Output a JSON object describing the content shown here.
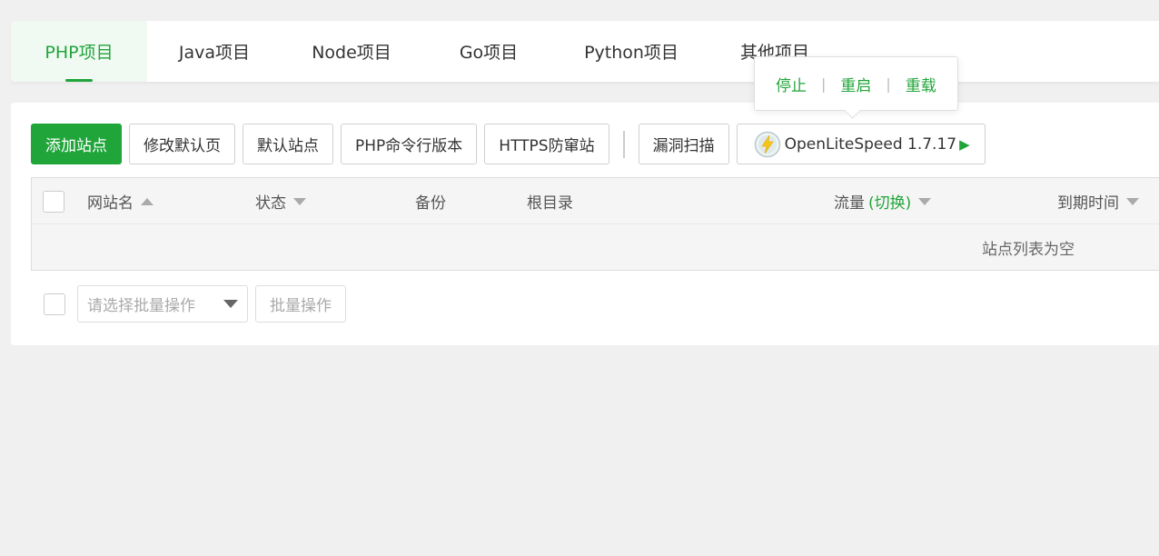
{
  "tabs": [
    {
      "label": "PHP项目",
      "active": true
    },
    {
      "label": "Java项目",
      "active": false
    },
    {
      "label": "Node项目",
      "active": false
    },
    {
      "label": "Go项目",
      "active": false
    },
    {
      "label": "Python项目",
      "active": false
    },
    {
      "label": "其他项目",
      "active": false
    }
  ],
  "toolbar": {
    "add_site": "添加站点",
    "edit_default_page": "修改默认页",
    "default_site": "默认站点",
    "php_cli_version": "PHP命令行版本",
    "https_anti_hijack": "HTTPS防窜站",
    "vuln_scan": "漏洞扫描",
    "server_name": "OpenLiteSpeed 1.7.17"
  },
  "popover": {
    "stop": "停止",
    "restart": "重启",
    "reload": "重载",
    "separator": "|"
  },
  "table": {
    "columns": {
      "site_name": "网站名",
      "status": "状态",
      "backup": "备份",
      "root_dir": "根目录",
      "traffic": "流量",
      "traffic_toggle": "(切换)",
      "expire": "到期时间"
    },
    "empty_text": "站点列表为空"
  },
  "batch": {
    "select_placeholder": "请选择批量操作",
    "batch_button": "批量操作"
  },
  "colors": {
    "accent": "#20a53a",
    "background": "#f0f0f0"
  }
}
